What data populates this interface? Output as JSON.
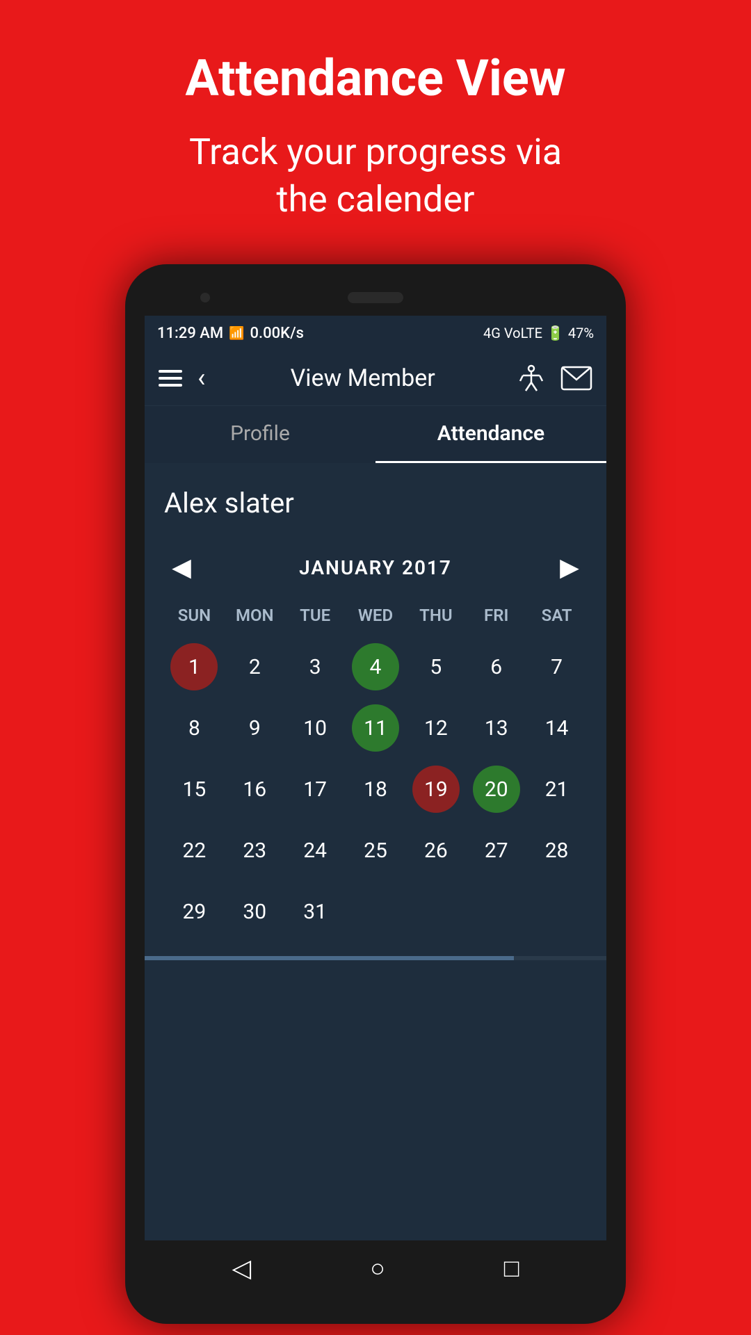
{
  "page": {
    "background_color": "#e8191a",
    "title": "Attendance View",
    "subtitle": "Track your progress via\nthe calender"
  },
  "status_bar": {
    "time": "11:29 AM",
    "data_speed": "0.00K/s",
    "network": "4G VoLTE",
    "battery": "47%"
  },
  "app_bar": {
    "title": "View Member",
    "back_label": "‹",
    "menu_label": "☰"
  },
  "tabs": [
    {
      "id": "profile",
      "label": "Profile",
      "active": false
    },
    {
      "id": "attendance",
      "label": "Attendance",
      "active": true
    }
  ],
  "member": {
    "name": "Alex slater"
  },
  "calendar": {
    "month_label": "JANUARY 2017",
    "day_headers": [
      "SUN",
      "MON",
      "TUE",
      "WED",
      "THU",
      "FRI",
      "SAT"
    ],
    "days": [
      {
        "num": 1,
        "state": "absent"
      },
      {
        "num": 2,
        "state": "normal"
      },
      {
        "num": 3,
        "state": "normal"
      },
      {
        "num": 4,
        "state": "present"
      },
      {
        "num": 5,
        "state": "normal"
      },
      {
        "num": 6,
        "state": "normal"
      },
      {
        "num": 7,
        "state": "normal"
      },
      {
        "num": 8,
        "state": "normal"
      },
      {
        "num": 9,
        "state": "normal"
      },
      {
        "num": 10,
        "state": "normal"
      },
      {
        "num": 11,
        "state": "present"
      },
      {
        "num": 12,
        "state": "normal"
      },
      {
        "num": 13,
        "state": "normal"
      },
      {
        "num": 14,
        "state": "normal"
      },
      {
        "num": 15,
        "state": "normal"
      },
      {
        "num": 16,
        "state": "normal"
      },
      {
        "num": 17,
        "state": "normal"
      },
      {
        "num": 18,
        "state": "normal"
      },
      {
        "num": 19,
        "state": "absent"
      },
      {
        "num": 20,
        "state": "present"
      },
      {
        "num": 21,
        "state": "normal"
      },
      {
        "num": 22,
        "state": "normal"
      },
      {
        "num": 23,
        "state": "normal"
      },
      {
        "num": 24,
        "state": "normal"
      },
      {
        "num": 25,
        "state": "normal"
      },
      {
        "num": 26,
        "state": "normal"
      },
      {
        "num": 27,
        "state": "normal"
      },
      {
        "num": 28,
        "state": "normal"
      },
      {
        "num": 29,
        "state": "normal"
      },
      {
        "num": 30,
        "state": "normal"
      },
      {
        "num": 31,
        "state": "normal"
      }
    ]
  },
  "bottom_nav": {
    "back_icon": "◁",
    "home_icon": "○",
    "recent_icon": "□"
  }
}
